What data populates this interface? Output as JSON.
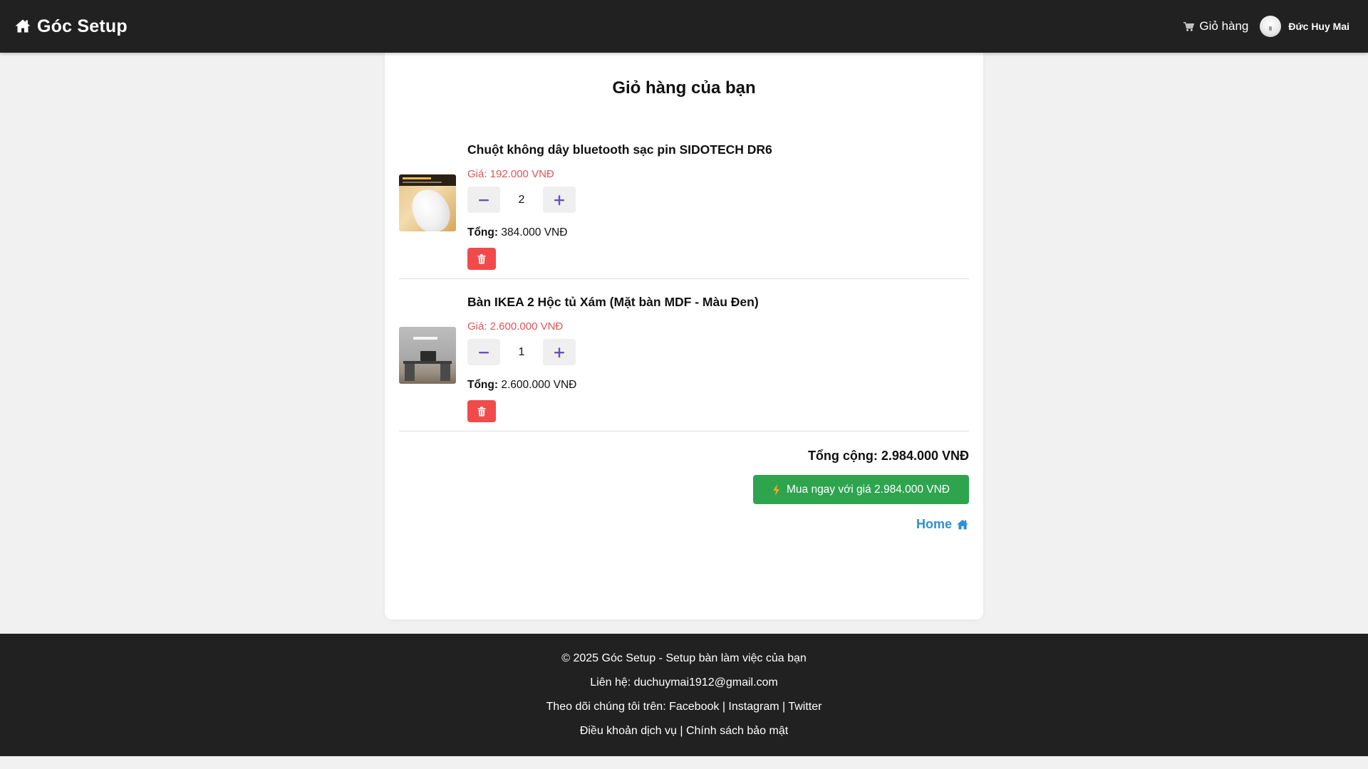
{
  "header": {
    "brand": "Góc Setup",
    "cart_label": "Giỏ hàng",
    "user_name": "Đức Huy Mai"
  },
  "cart": {
    "title": "Giỏ hàng của bạn",
    "total_label": "Tổng:",
    "items": [
      {
        "name": "Chuột không dây bluetooth sạc pin SIDOTECH DR6",
        "price": "Giá: 192.000 VNĐ",
        "quantity": "2",
        "total": "384.000 VNĐ"
      },
      {
        "name": "Bàn IKEA 2 Hộc tủ Xám (Mặt bàn MDF - Màu Đen)",
        "price": "Giá: 2.600.000 VNĐ",
        "quantity": "1",
        "total": "2.600.000 VNĐ"
      }
    ],
    "grand_total": "Tổng cộng: 2.984.000 VNĐ",
    "buy_label": "Mua ngay với giá 2.984.000 VNĐ",
    "home_label": "Home"
  },
  "footer": {
    "copyright": "© 2025 Góc Setup - Setup bàn làm việc của bạn",
    "contact": "Liên hệ: duchuymai1912@gmail.com",
    "follow_prefix": "Theo dõi chúng tôi trên:",
    "social": [
      "Facebook",
      "Instagram",
      "Twitter"
    ],
    "terms": "Điều khoản dịch vụ",
    "privacy": "Chính sách bảo mật",
    "separator": "|"
  },
  "colors": {
    "header_bg": "#212121",
    "price_red": "#e05555",
    "delete_red": "#f24a4a",
    "buy_green": "#2ea44f",
    "link_blue": "#2f8fd8",
    "qty_icon_purple": "#6a4cc7"
  },
  "icons": {
    "brand": "home-icon",
    "cart": "cart-icon",
    "minus": "minus-icon",
    "plus": "plus-icon",
    "delete": "trash-icon",
    "buy": "lightning-icon",
    "home": "home-icon"
  }
}
